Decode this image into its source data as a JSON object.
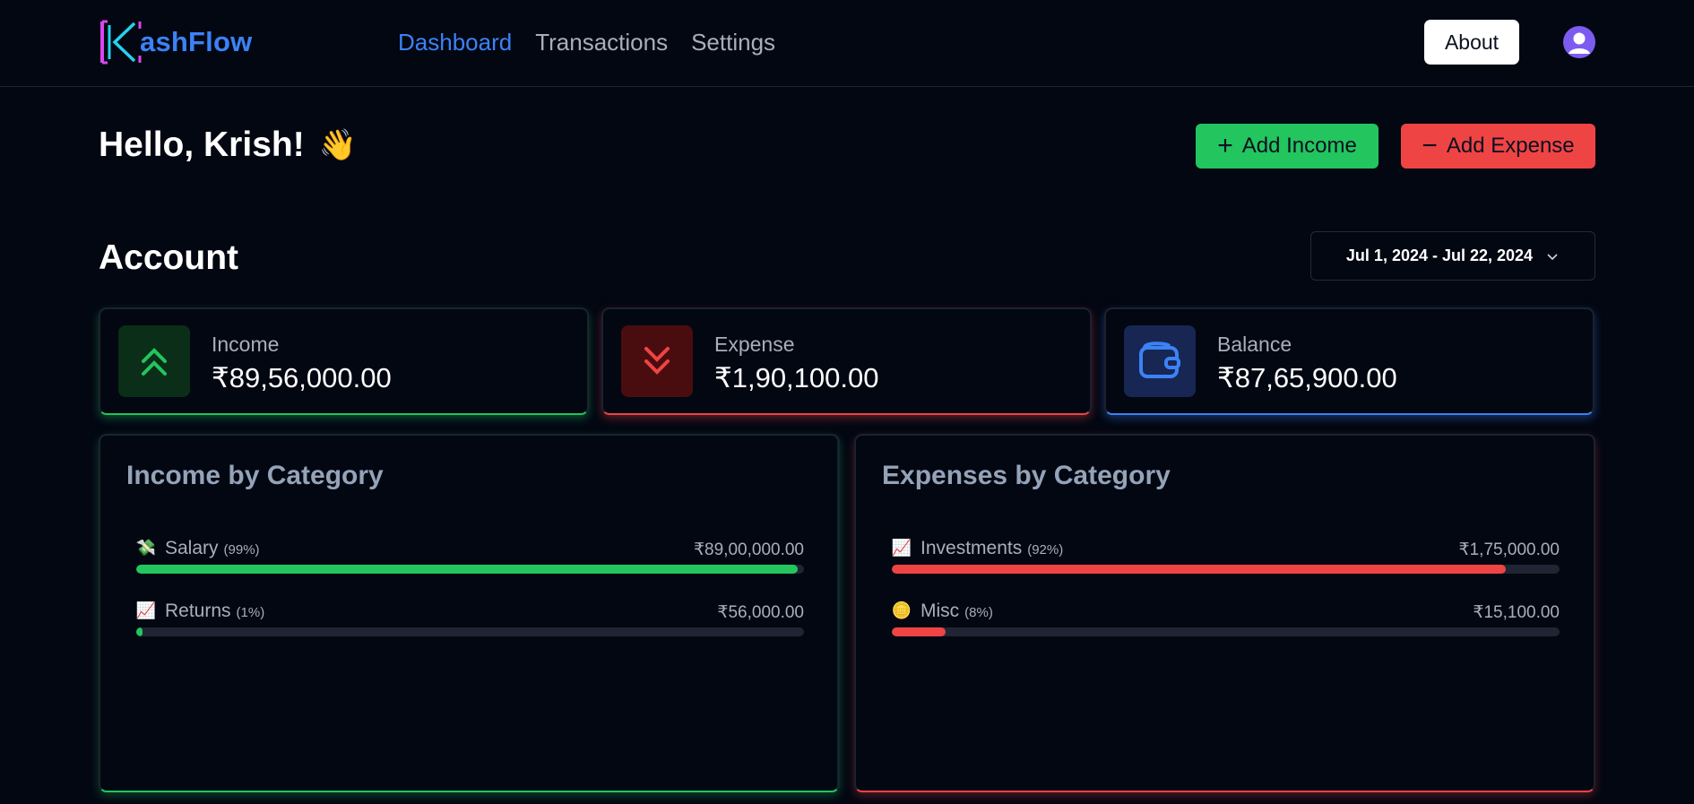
{
  "app": {
    "logo_text": "ashFlow",
    "colors": {
      "accent": "#3b82f6",
      "income": "#22c55e",
      "expense": "#ef4444",
      "background": "#030712"
    }
  },
  "nav": {
    "items": [
      {
        "label": "Dashboard",
        "active": true
      },
      {
        "label": "Transactions",
        "active": false
      },
      {
        "label": "Settings",
        "active": false
      }
    ]
  },
  "header": {
    "about_label": "About",
    "avatar_icon": "user-icon"
  },
  "greeting": {
    "text": "Hello, Krish!",
    "emoji": "👋"
  },
  "actions": {
    "add_income_label": "Add Income",
    "add_expense_label": "Add Expense"
  },
  "account": {
    "title": "Account",
    "date_range": "Jul 1, 2024 - Jul 22, 2024",
    "stats": {
      "income": {
        "label": "Income",
        "value": "₹89,56,000.00",
        "icon": "chevrons-up-icon"
      },
      "expense": {
        "label": "Expense",
        "value": "₹1,90,100.00",
        "icon": "chevrons-down-icon"
      },
      "balance": {
        "label": "Balance",
        "value": "₹87,65,900.00",
        "icon": "wallet-icon"
      }
    }
  },
  "income_by_category": {
    "title": "Income by Category",
    "items": [
      {
        "emoji": "💸",
        "name": "Salary",
        "percent_label": "(99%)",
        "amount": "₹89,00,000.00",
        "fraction": 0.99
      },
      {
        "emoji": "📈",
        "name": "Returns",
        "percent_label": "(1%)",
        "amount": "₹56,000.00",
        "fraction": 0.01
      }
    ]
  },
  "expenses_by_category": {
    "title": "Expenses by Category",
    "items": [
      {
        "emoji": "📈",
        "name": "Investments",
        "percent_label": "(92%)",
        "amount": "₹1,75,000.00",
        "fraction": 0.92
      },
      {
        "emoji": "🪙",
        "name": "Misc",
        "percent_label": "(8%)",
        "amount": "₹15,100.00",
        "fraction": 0.08
      }
    ]
  }
}
